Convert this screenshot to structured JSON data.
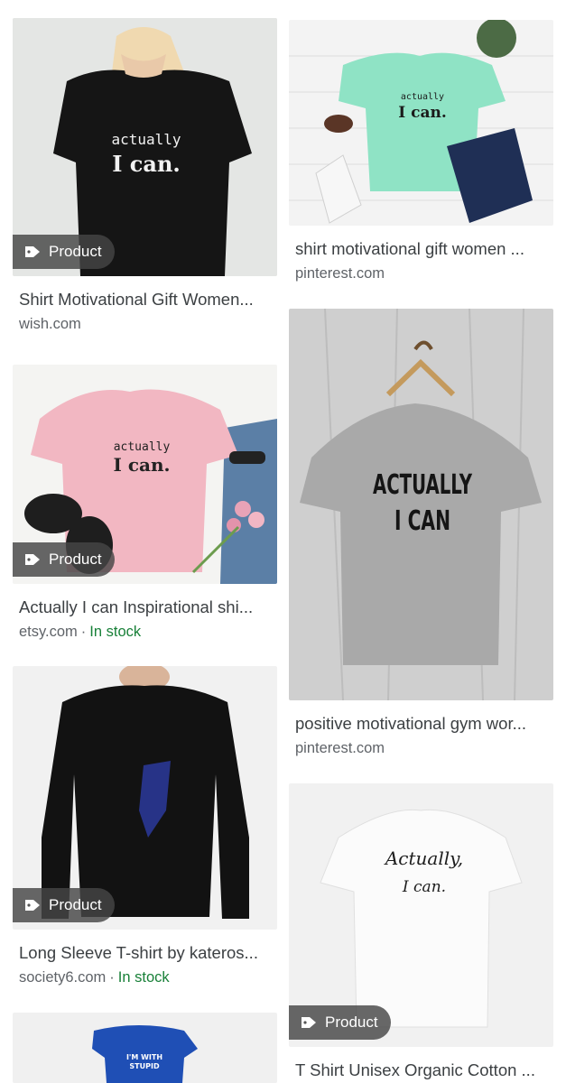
{
  "badge_label": "Product",
  "results": [
    {
      "title": "Shirt Motivational Gift Women...",
      "source": "wish.com",
      "stock": "",
      "shirt_text_1": "actually",
      "shirt_text_2": "I can."
    },
    {
      "title": "shirt motivational gift women ...",
      "source": "pinterest.com",
      "stock": "",
      "shirt_text_1": "actually",
      "shirt_text_2": "I can."
    },
    {
      "title": "Actually I can Inspirational shi...",
      "source": "etsy.com",
      "stock": "In stock",
      "shirt_text_1": "actually",
      "shirt_text_2": "I can."
    },
    {
      "title": "positive motivational gym wor...",
      "source": "pinterest.com",
      "stock": "",
      "shirt_text_1": "ACTUALLY",
      "shirt_text_2": "I CAN"
    },
    {
      "title": "Long Sleeve T-shirt by kateros...",
      "source": "society6.com",
      "stock": "In stock",
      "shirt_text_1": "",
      "shirt_text_2": ""
    },
    {
      "title": "T Shirt Unisex Organic Cotton ...",
      "source": "",
      "stock": "",
      "shirt_text_1": "Actually,",
      "shirt_text_2": "I can."
    },
    {
      "title": "",
      "source": "",
      "stock": "",
      "shirt_text_1": "I'M WITH",
      "shirt_text_2": "STUPID"
    }
  ],
  "colors": {
    "stock": "#188038",
    "badge_bg": "#464646",
    "link_text": "#3c4043",
    "meta_text": "#5f6368"
  }
}
